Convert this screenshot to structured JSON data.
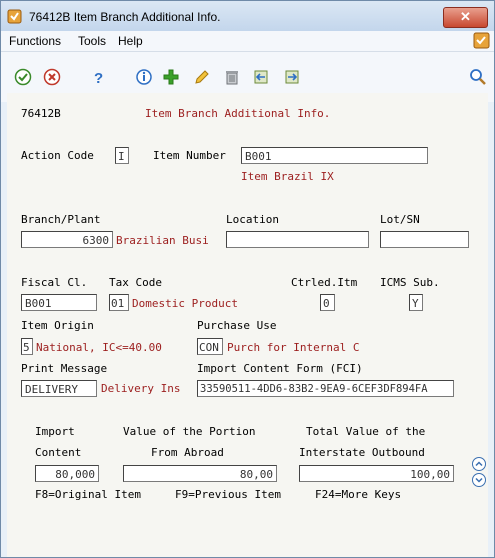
{
  "window": {
    "title": "76412B   Item Branch Additional Info.",
    "close_label": "✕"
  },
  "menu": {
    "functions": "Functions",
    "tools": "Tools",
    "help": "Help"
  },
  "toolbar": {
    "icons": [
      "checkmark-icon",
      "cancel-icon",
      "help-icon",
      "info-icon",
      "add-icon",
      "edit-icon",
      "delete-icon",
      "import-icon",
      "export-icon",
      "search-icon"
    ]
  },
  "header": {
    "program_id": "76412B",
    "form_title": "Item Branch Additional Info."
  },
  "form": {
    "action_code_label": "Action Code",
    "action_code_value": "I",
    "item_number_label": "Item Number",
    "item_number_value": "B001",
    "item_description": "Item Brazil IX",
    "branch_plant_label": "Branch/Plant",
    "branch_plant_value": "6300",
    "branch_plant_desc": "Brazilian Busi",
    "location_label": "Location",
    "location_value": "",
    "lot_sn_label": "Lot/SN",
    "lot_sn_value": "",
    "fiscal_cl_label": "Fiscal Cl.",
    "fiscal_cl_value": "B001",
    "tax_code_label": "Tax Code",
    "tax_code_value": "01",
    "tax_code_desc": "Domestic Product",
    "ctrled_itm_label": "Ctrled.Itm",
    "ctrled_itm_value": "0",
    "icms_sub_label": "ICMS Sub.",
    "icms_sub_value": "Y",
    "item_origin_label": "Item Origin",
    "item_origin_value": "5",
    "item_origin_desc": "National, IC<=40.00",
    "purchase_use_label": "Purchase Use",
    "purchase_use_value": "CON",
    "purchase_use_desc": "Purch for Internal C",
    "print_message_label": "Print Message",
    "print_message_value": "DELIVERY",
    "print_message_desc": "Delivery Ins",
    "fci_label": "Import Content Form (FCI)",
    "fci_value": "33590511-4DD6-83B2-9EA9-6CEF3DF894FA",
    "import_label_1": "Import",
    "import_label_2": "Content",
    "import_value": "80,000",
    "portion_label_1": "Value of the Portion",
    "portion_label_2": "From Abroad",
    "portion_value": "80,00",
    "interstate_label_1": "Total Value of the",
    "interstate_label_2": "Interstate Outbound",
    "interstate_value": "100,00"
  },
  "footer": {
    "f8": "F8=Original Item",
    "f9": "F9=Previous Item",
    "f24": "F24=More Keys"
  }
}
